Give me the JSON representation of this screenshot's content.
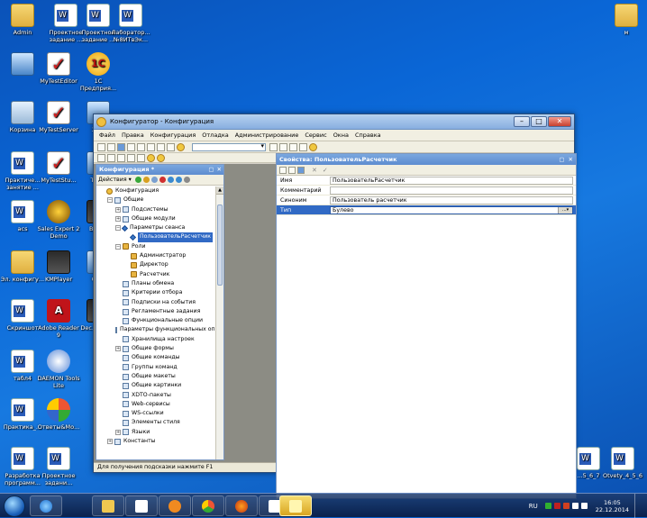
{
  "desktop_icons": [
    {
      "label": "Admin",
      "kind": "folder"
    },
    {
      "label": "Проектное задание ...",
      "kind": "doc"
    },
    {
      "label": "Проектное задание ...",
      "kind": "doc"
    },
    {
      "label": "Лаборатор... №8ИТвЭк...",
      "kind": "doc"
    },
    {
      "label": "м",
      "kind": "folder"
    },
    {
      "label": "",
      "kind": "pc"
    },
    {
      "label": "MyTestEditor",
      "kind": "test"
    },
    {
      "label": "1С Предприя...",
      "kind": "c1"
    },
    {
      "label": "Корзина",
      "kind": "bin"
    },
    {
      "label": "MyTestServer",
      "kind": "test"
    },
    {
      "label": "3d...",
      "kind": "pc"
    },
    {
      "label": "Практиче... занятие ...",
      "kind": "doc"
    },
    {
      "label": "MyTestStu...",
      "kind": "test"
    },
    {
      "label": "Tea...",
      "kind": "pc"
    },
    {
      "label": "acs",
      "kind": "doc"
    },
    {
      "label": "Sales Expert 2 Demo",
      "kind": "bee"
    },
    {
      "label": "Blac...",
      "kind": "km"
    },
    {
      "label": "Эл. конфигу...",
      "kind": "folder"
    },
    {
      "label": "KMPlayer",
      "kind": "km"
    },
    {
      "label": "Gli...",
      "kind": "pc"
    },
    {
      "label": "Скриншот",
      "kind": "doc"
    },
    {
      "label": "Adobe Reader 9",
      "kind": "pdf"
    },
    {
      "label": "Dec... Sha...",
      "kind": "km"
    },
    {
      "label": "табл4",
      "kind": "doc"
    },
    {
      "label": "DAEMON Tools Lite",
      "kind": "daemon"
    },
    {
      "label": "Практика_...",
      "kind": "doc"
    },
    {
      "label": "Ответы&Mo...",
      "kind": "ones"
    },
    {
      "label": "Разработка программ...",
      "kind": "doc"
    },
    {
      "label": "Проектное задани...",
      "kind": "doc"
    },
    {
      "label": "Otvety_4_5_6",
      "kind": "doc"
    },
    {
      "label": "...5_6_7",
      "kind": "doc"
    }
  ],
  "window": {
    "title": "Конфигуратор - Конфигурация",
    "controls": {
      "minimize": "–",
      "maximize": "□",
      "close": "✕"
    },
    "menu": [
      "Файл",
      "Правка",
      "Конфигурация",
      "Отладка",
      "Администрирование",
      "Сервис",
      "Окна",
      "Справка"
    ],
    "status": "Для получения подсказки нажмите F1"
  },
  "config_panel": {
    "title": "Конфигурация *",
    "actions_label": "Действия ▾",
    "tree": [
      {
        "label": "Конфигурация",
        "level": 0,
        "icon": "round",
        "exp": ""
      },
      {
        "label": "Общие",
        "level": 1,
        "icon": "plain",
        "exp": "−"
      },
      {
        "label": "Подсистемы",
        "level": 2,
        "icon": "plain",
        "exp": "+"
      },
      {
        "label": "Общие модули",
        "level": 2,
        "icon": "plain",
        "exp": "+"
      },
      {
        "label": "Параметры сеанса",
        "level": 2,
        "icon": "diamond",
        "exp": "−"
      },
      {
        "label": "ПользовательРасчетчик",
        "level": 3,
        "icon": "diamond",
        "exp": "",
        "selected": true
      },
      {
        "label": "Роли",
        "level": 2,
        "icon": "key",
        "exp": "−"
      },
      {
        "label": "Администратор",
        "level": 3,
        "icon": "key",
        "exp": ""
      },
      {
        "label": "Директор",
        "level": 3,
        "icon": "key",
        "exp": ""
      },
      {
        "label": "Расчетчик",
        "level": 3,
        "icon": "key",
        "exp": ""
      },
      {
        "label": "Планы обмена",
        "level": 2,
        "icon": "plain",
        "exp": ""
      },
      {
        "label": "Критерии отбора",
        "level": 2,
        "icon": "plain",
        "exp": ""
      },
      {
        "label": "Подписки на события",
        "level": 2,
        "icon": "plain",
        "exp": ""
      },
      {
        "label": "Регламентные задания",
        "level": 2,
        "icon": "plain",
        "exp": ""
      },
      {
        "label": "Функциональные опции",
        "level": 2,
        "icon": "plain",
        "exp": ""
      },
      {
        "label": "Параметры функциональных опц",
        "level": 2,
        "icon": "plain",
        "exp": ""
      },
      {
        "label": "Хранилища настроек",
        "level": 2,
        "icon": "plain",
        "exp": ""
      },
      {
        "label": "Общие формы",
        "level": 2,
        "icon": "plain",
        "exp": "+"
      },
      {
        "label": "Общие команды",
        "level": 2,
        "icon": "plain",
        "exp": ""
      },
      {
        "label": "Группы команд",
        "level": 2,
        "icon": "plain",
        "exp": ""
      },
      {
        "label": "Общие макеты",
        "level": 2,
        "icon": "plain",
        "exp": ""
      },
      {
        "label": "Общие картинки",
        "level": 2,
        "icon": "plain",
        "exp": ""
      },
      {
        "label": "XDTO-пакеты",
        "level": 2,
        "icon": "plain",
        "exp": ""
      },
      {
        "label": "Web-сервисы",
        "level": 2,
        "icon": "plain",
        "exp": ""
      },
      {
        "label": "WS-ссылки",
        "level": 2,
        "icon": "plain",
        "exp": ""
      },
      {
        "label": "Элементы стиля",
        "level": 2,
        "icon": "plain",
        "exp": ""
      },
      {
        "label": "Языки",
        "level": 2,
        "icon": "plain",
        "exp": "+"
      },
      {
        "label": "Константы",
        "level": 1,
        "icon": "plain",
        "exp": "+"
      }
    ]
  },
  "properties_panel": {
    "title": "Свойства: ПользовательРасчетчик",
    "rows": [
      {
        "name": "Имя",
        "value": "ПользовательРасчетчик"
      },
      {
        "name": "Комментарий",
        "value": ""
      },
      {
        "name": "Синоним",
        "value": "Пользователь расчетчик"
      },
      {
        "name": "Тип",
        "value": "Булево",
        "selected": true
      }
    ]
  },
  "taskbar": {
    "language": "RU",
    "time": "16:05",
    "date": "22.12.2014"
  },
  "colors": {
    "selection": "#316ac5",
    "panel_title": "#5d8cd0",
    "desktop": "#0a66d6"
  }
}
